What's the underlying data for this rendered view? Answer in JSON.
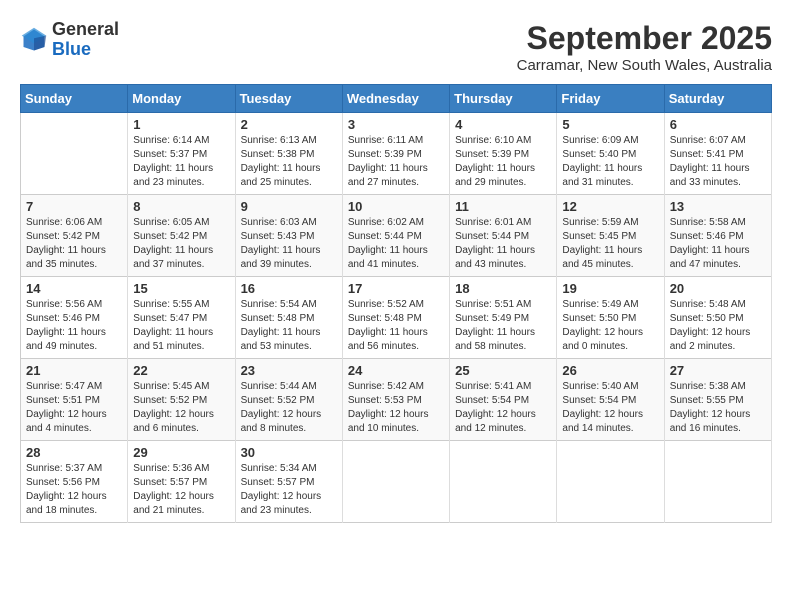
{
  "header": {
    "logo": {
      "line1": "General",
      "line2": "Blue"
    },
    "title": "September 2025",
    "location": "Carramar, New South Wales, Australia"
  },
  "weekdays": [
    "Sunday",
    "Monday",
    "Tuesday",
    "Wednesday",
    "Thursday",
    "Friday",
    "Saturday"
  ],
  "weeks": [
    [
      {
        "day": "",
        "sunrise": "",
        "sunset": "",
        "daylight": ""
      },
      {
        "day": "1",
        "sunrise": "Sunrise: 6:14 AM",
        "sunset": "Sunset: 5:37 PM",
        "daylight": "Daylight: 11 hours and 23 minutes."
      },
      {
        "day": "2",
        "sunrise": "Sunrise: 6:13 AM",
        "sunset": "Sunset: 5:38 PM",
        "daylight": "Daylight: 11 hours and 25 minutes."
      },
      {
        "day": "3",
        "sunrise": "Sunrise: 6:11 AM",
        "sunset": "Sunset: 5:39 PM",
        "daylight": "Daylight: 11 hours and 27 minutes."
      },
      {
        "day": "4",
        "sunrise": "Sunrise: 6:10 AM",
        "sunset": "Sunset: 5:39 PM",
        "daylight": "Daylight: 11 hours and 29 minutes."
      },
      {
        "day": "5",
        "sunrise": "Sunrise: 6:09 AM",
        "sunset": "Sunset: 5:40 PM",
        "daylight": "Daylight: 11 hours and 31 minutes."
      },
      {
        "day": "6",
        "sunrise": "Sunrise: 6:07 AM",
        "sunset": "Sunset: 5:41 PM",
        "daylight": "Daylight: 11 hours and 33 minutes."
      }
    ],
    [
      {
        "day": "7",
        "sunrise": "Sunrise: 6:06 AM",
        "sunset": "Sunset: 5:42 PM",
        "daylight": "Daylight: 11 hours and 35 minutes."
      },
      {
        "day": "8",
        "sunrise": "Sunrise: 6:05 AM",
        "sunset": "Sunset: 5:42 PM",
        "daylight": "Daylight: 11 hours and 37 minutes."
      },
      {
        "day": "9",
        "sunrise": "Sunrise: 6:03 AM",
        "sunset": "Sunset: 5:43 PM",
        "daylight": "Daylight: 11 hours and 39 minutes."
      },
      {
        "day": "10",
        "sunrise": "Sunrise: 6:02 AM",
        "sunset": "Sunset: 5:44 PM",
        "daylight": "Daylight: 11 hours and 41 minutes."
      },
      {
        "day": "11",
        "sunrise": "Sunrise: 6:01 AM",
        "sunset": "Sunset: 5:44 PM",
        "daylight": "Daylight: 11 hours and 43 minutes."
      },
      {
        "day": "12",
        "sunrise": "Sunrise: 5:59 AM",
        "sunset": "Sunset: 5:45 PM",
        "daylight": "Daylight: 11 hours and 45 minutes."
      },
      {
        "day": "13",
        "sunrise": "Sunrise: 5:58 AM",
        "sunset": "Sunset: 5:46 PM",
        "daylight": "Daylight: 11 hours and 47 minutes."
      }
    ],
    [
      {
        "day": "14",
        "sunrise": "Sunrise: 5:56 AM",
        "sunset": "Sunset: 5:46 PM",
        "daylight": "Daylight: 11 hours and 49 minutes."
      },
      {
        "day": "15",
        "sunrise": "Sunrise: 5:55 AM",
        "sunset": "Sunset: 5:47 PM",
        "daylight": "Daylight: 11 hours and 51 minutes."
      },
      {
        "day": "16",
        "sunrise": "Sunrise: 5:54 AM",
        "sunset": "Sunset: 5:48 PM",
        "daylight": "Daylight: 11 hours and 53 minutes."
      },
      {
        "day": "17",
        "sunrise": "Sunrise: 5:52 AM",
        "sunset": "Sunset: 5:48 PM",
        "daylight": "Daylight: 11 hours and 56 minutes."
      },
      {
        "day": "18",
        "sunrise": "Sunrise: 5:51 AM",
        "sunset": "Sunset: 5:49 PM",
        "daylight": "Daylight: 11 hours and 58 minutes."
      },
      {
        "day": "19",
        "sunrise": "Sunrise: 5:49 AM",
        "sunset": "Sunset: 5:50 PM",
        "daylight": "Daylight: 12 hours and 0 minutes."
      },
      {
        "day": "20",
        "sunrise": "Sunrise: 5:48 AM",
        "sunset": "Sunset: 5:50 PM",
        "daylight": "Daylight: 12 hours and 2 minutes."
      }
    ],
    [
      {
        "day": "21",
        "sunrise": "Sunrise: 5:47 AM",
        "sunset": "Sunset: 5:51 PM",
        "daylight": "Daylight: 12 hours and 4 minutes."
      },
      {
        "day": "22",
        "sunrise": "Sunrise: 5:45 AM",
        "sunset": "Sunset: 5:52 PM",
        "daylight": "Daylight: 12 hours and 6 minutes."
      },
      {
        "day": "23",
        "sunrise": "Sunrise: 5:44 AM",
        "sunset": "Sunset: 5:52 PM",
        "daylight": "Daylight: 12 hours and 8 minutes."
      },
      {
        "day": "24",
        "sunrise": "Sunrise: 5:42 AM",
        "sunset": "Sunset: 5:53 PM",
        "daylight": "Daylight: 12 hours and 10 minutes."
      },
      {
        "day": "25",
        "sunrise": "Sunrise: 5:41 AM",
        "sunset": "Sunset: 5:54 PM",
        "daylight": "Daylight: 12 hours and 12 minutes."
      },
      {
        "day": "26",
        "sunrise": "Sunrise: 5:40 AM",
        "sunset": "Sunset: 5:54 PM",
        "daylight": "Daylight: 12 hours and 14 minutes."
      },
      {
        "day": "27",
        "sunrise": "Sunrise: 5:38 AM",
        "sunset": "Sunset: 5:55 PM",
        "daylight": "Daylight: 12 hours and 16 minutes."
      }
    ],
    [
      {
        "day": "28",
        "sunrise": "Sunrise: 5:37 AM",
        "sunset": "Sunset: 5:56 PM",
        "daylight": "Daylight: 12 hours and 18 minutes."
      },
      {
        "day": "29",
        "sunrise": "Sunrise: 5:36 AM",
        "sunset": "Sunset: 5:57 PM",
        "daylight": "Daylight: 12 hours and 21 minutes."
      },
      {
        "day": "30",
        "sunrise": "Sunrise: 5:34 AM",
        "sunset": "Sunset: 5:57 PM",
        "daylight": "Daylight: 12 hours and 23 minutes."
      },
      {
        "day": "",
        "sunrise": "",
        "sunset": "",
        "daylight": ""
      },
      {
        "day": "",
        "sunrise": "",
        "sunset": "",
        "daylight": ""
      },
      {
        "day": "",
        "sunrise": "",
        "sunset": "",
        "daylight": ""
      },
      {
        "day": "",
        "sunrise": "",
        "sunset": "",
        "daylight": ""
      }
    ]
  ]
}
